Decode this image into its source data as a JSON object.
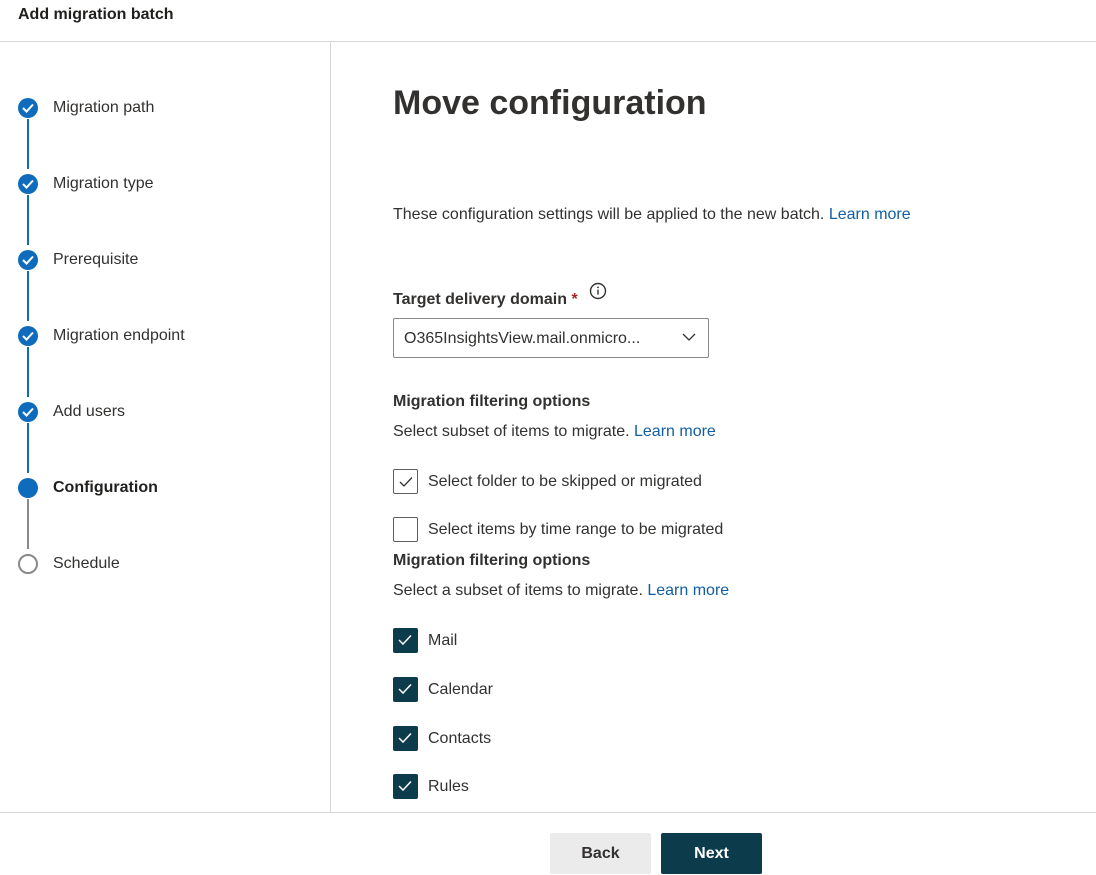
{
  "header": {
    "title": "Add migration batch"
  },
  "steps": [
    {
      "label": "Migration path",
      "state": "done"
    },
    {
      "label": "Migration type",
      "state": "done"
    },
    {
      "label": "Prerequisite",
      "state": "done"
    },
    {
      "label": "Migration endpoint",
      "state": "done"
    },
    {
      "label": "Add users",
      "state": "done"
    },
    {
      "label": "Configuration",
      "state": "current"
    },
    {
      "label": "Schedule",
      "state": "todo"
    }
  ],
  "main": {
    "title": "Move configuration",
    "description": "These configuration settings will be applied to the new batch.",
    "description_link": "Learn more",
    "target_domain": {
      "label": "Target delivery domain",
      "required_mark": "*",
      "value": "O365InsightsView.mail.onmicro..."
    },
    "filter_section_1": {
      "title": "Migration filtering options",
      "subtitle": "Select subset of items to migrate.",
      "link": "Learn more",
      "options": [
        {
          "label": "Select folder to be skipped or migrated",
          "checked": true
        },
        {
          "label": "Select items by time range to be migrated",
          "checked": false
        }
      ]
    },
    "filter_section_2": {
      "title": "Migration filtering options",
      "subtitle": "Select a subset of items to migrate.",
      "link": "Learn more",
      "options": [
        {
          "label": "Mail",
          "checked": true
        },
        {
          "label": "Calendar",
          "checked": true
        },
        {
          "label": "Contacts",
          "checked": true
        },
        {
          "label": "Rules",
          "checked": true
        }
      ]
    }
  },
  "footer": {
    "back_label": "Back",
    "next_label": "Next"
  },
  "colors": {
    "accent": "#0f6cbd",
    "primary_button": "#0c3b4c",
    "link": "#115ea3"
  }
}
